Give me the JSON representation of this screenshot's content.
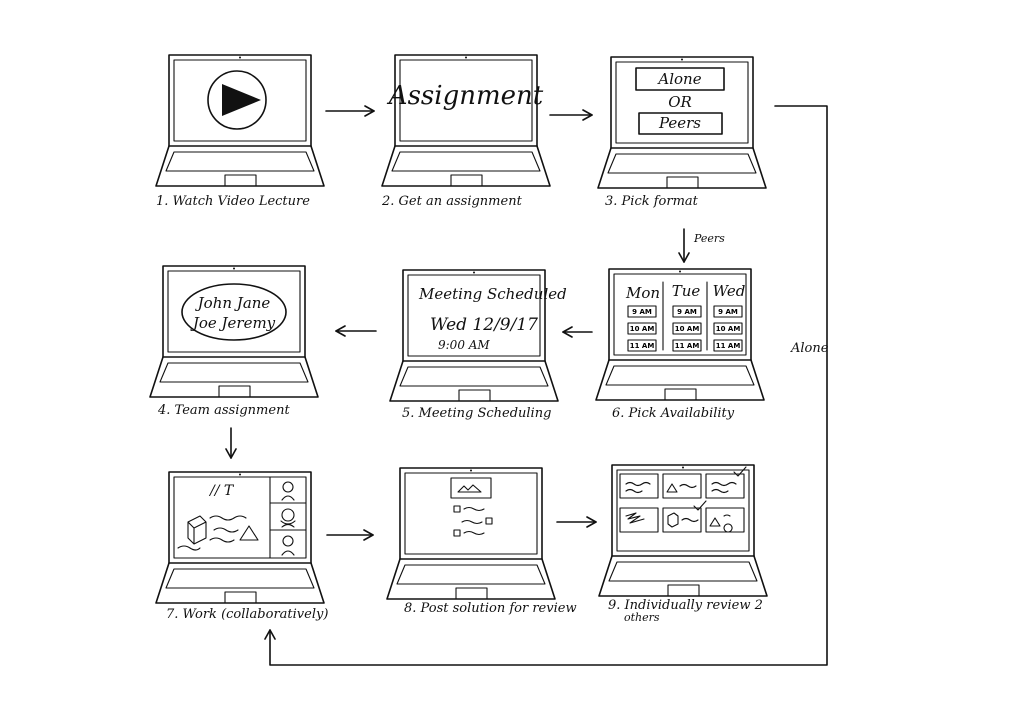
{
  "steps": [
    {
      "caption": "1. Watch Video Lecture"
    },
    {
      "caption": "2. Get an assignment",
      "screen_text": "Assignment"
    },
    {
      "caption": "3. Pick format",
      "option_alone": "Alone",
      "or_text": "OR",
      "option_peers": "Peers"
    },
    {
      "caption": "4. Team assignment",
      "names_line1": "John  Jane",
      "names_line2": "Joe  Jeremy"
    },
    {
      "caption": "5. Meeting Scheduling",
      "title": "Meeting Scheduled",
      "date": "Wed  12/9/17",
      "time": "9:00 AM"
    },
    {
      "caption": "6. Pick Availability",
      "days": [
        "Mon",
        "Tue",
        "Wed"
      ],
      "slots": [
        "9 AM",
        "10 AM",
        "11 AM"
      ]
    },
    {
      "caption": "7. Work (collaboratively)",
      "tool_text": "// T"
    },
    {
      "caption": "8. Post solution for review"
    },
    {
      "caption": "9. Individually review 2",
      "caption_line2": "others"
    }
  ],
  "arrows": {
    "peers_label": "Peers",
    "alone_label": "Alone"
  }
}
